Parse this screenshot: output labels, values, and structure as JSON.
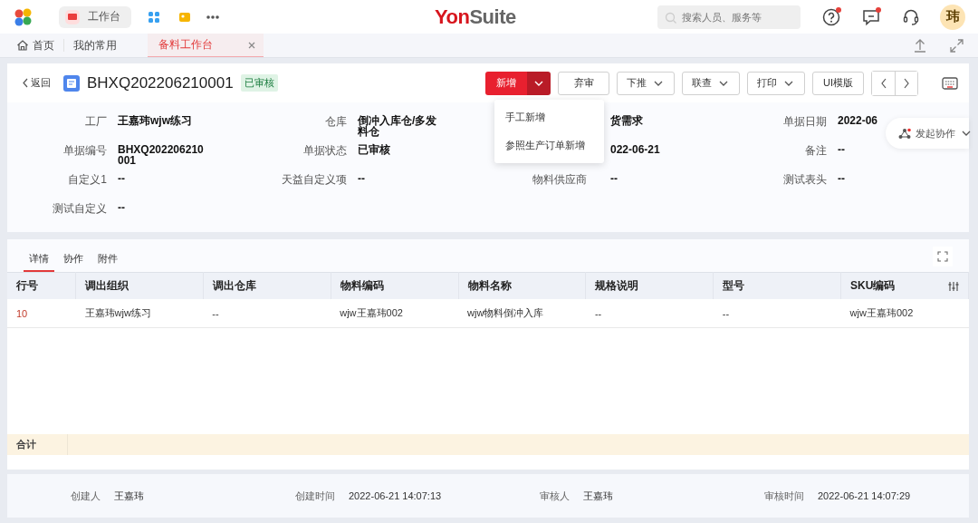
{
  "topbar": {
    "workbench": {
      "label": "工作台",
      "selected": true
    },
    "logo": {
      "part1": "Yon",
      "part2": "Suite"
    },
    "search": {
      "placeholder": "搜索人员、服务等"
    },
    "icons": [
      {
        "kind": "help",
        "badge": true
      },
      {
        "kind": "message",
        "badge": true
      },
      {
        "kind": "headset",
        "badge": false
      }
    ],
    "avatar": "玮"
  },
  "tabs": [
    {
      "label": "首页",
      "kind": "home",
      "selected": false
    },
    {
      "label": "我的常用",
      "kind": "plain",
      "selected": false
    },
    {
      "label": "备料工作台",
      "kind": "closable",
      "selected": true
    }
  ],
  "document": {
    "back": "返回",
    "code": "BHXQ202206210001",
    "status": "已审核",
    "buttons": [
      {
        "label": "新增",
        "kind": "split"
      },
      {
        "label": "弃审",
        "kind": "plain"
      },
      {
        "label": "下推",
        "kind": "dropdown"
      },
      {
        "label": "联查",
        "kind": "dropdown"
      },
      {
        "label": "打印",
        "kind": "dropdown"
      },
      {
        "label": "UI模版",
        "kind": "plain"
      }
    ],
    "menu": [
      "手工新增",
      "参照生产订单新增"
    ],
    "collaborate": "发起协作",
    "fields": [
      {
        "label": "工厂",
        "value": "王嘉玮wjw练习"
      },
      {
        "label": "仓库",
        "value": "倒冲入库仓/多发料仓"
      },
      {
        "value": "货需求"
      },
      {
        "label": "单据日期",
        "value": "2022-06"
      },
      {
        "label": "单据编号",
        "value": "BHXQ202206210001"
      },
      {
        "label": "单据状态",
        "value": "已审核"
      },
      {
        "value": "022-06-21"
      },
      {
        "label": "备注",
        "value": "--"
      },
      {
        "label": "自定义1",
        "value": "--"
      },
      {
        "label": "天益自定义项",
        "value": "--"
      },
      {
        "label": "物料供应商",
        "value": "--"
      },
      {
        "label": "测试表头",
        "value": "--"
      },
      {
        "label": "测试自定义",
        "value": "--"
      }
    ]
  },
  "details": {
    "tabs": [
      {
        "label": "详情",
        "selected": true
      },
      {
        "label": "协作",
        "selected": false
      },
      {
        "label": "附件",
        "selected": false
      }
    ],
    "columns": [
      "行号",
      "调出组织",
      "调出仓库",
      "物料编码",
      "物料名称",
      "规格说明",
      "型号",
      "SKU编码"
    ],
    "rows": [
      [
        "10",
        "王嘉玮wjw练习",
        "--",
        "wjw王嘉玮002",
        "wjw物料倒冲入库",
        "--",
        "--",
        "wjw王嘉玮002"
      ]
    ],
    "total_label": "合计"
  },
  "footer": [
    {
      "label": "创建人",
      "value": "王嘉玮"
    },
    {
      "label": "创建时间",
      "value": "2022-06-21 14:07:13"
    },
    {
      "label": "审核人",
      "value": "王嘉玮"
    },
    {
      "label": "审核时间",
      "value": "2022-06-21 14:07:29"
    }
  ]
}
